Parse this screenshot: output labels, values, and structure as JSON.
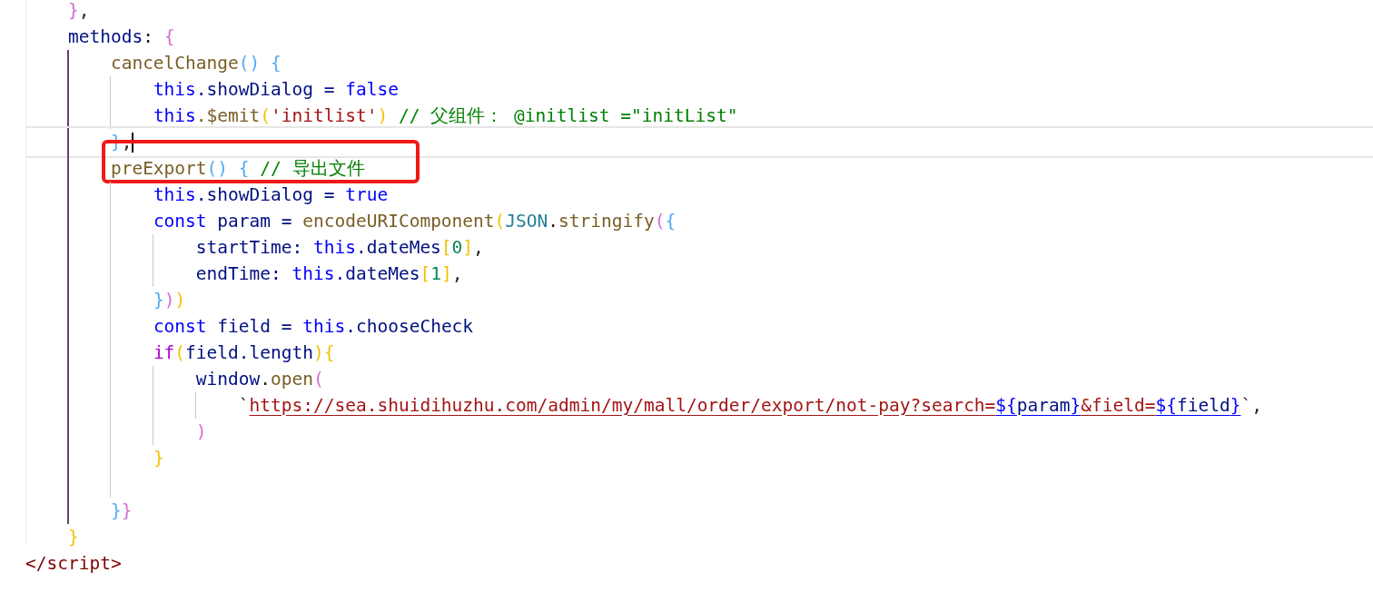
{
  "editor": {
    "lines": [
      {
        "kind": "code",
        "current": false,
        "annotated": false,
        "tokens": [
          {
            "text": "}",
            "kind": "b2"
          },
          {
            "text": ",",
            "kind": "p"
          }
        ]
      },
      {
        "kind": "code",
        "current": false,
        "annotated": false,
        "tokens": [
          {
            "text": "methods",
            "kind": "v"
          },
          {
            "text": ": ",
            "kind": "p"
          },
          {
            "text": "{",
            "kind": "b2"
          }
        ],
        "children": [
          {
            "kind": "code",
            "current": false,
            "annotated": false,
            "tokens": [
              {
                "text": "cancelChange",
                "kind": "f"
              },
              {
                "text": "() {",
                "kind": "b3"
              }
            ],
            "children": [
              {
                "kind": "code",
                "current": false,
                "annotated": false,
                "tokens": [
                  {
                    "text": "this",
                    "kind": "k"
                  },
                  {
                    "text": ".showDialog = ",
                    "kind": "v"
                  },
                  {
                    "text": "false",
                    "kind": "k"
                  }
                ]
              },
              {
                "kind": "code",
                "current": false,
                "annotated": false,
                "tokens": [
                  {
                    "text": "this",
                    "kind": "k"
                  },
                  {
                    "text": ".$emit",
                    "kind": "f"
                  },
                  {
                    "text": "(",
                    "kind": "b1"
                  },
                  {
                    "text": "'initlist'",
                    "kind": "s"
                  },
                  {
                    "text": ")",
                    "kind": "b1"
                  },
                  {
                    "text": " // 父组件： @initlist =\"initList\"",
                    "kind": "c"
                  }
                ]
              }
            ]
          },
          {
            "kind": "code",
            "current": true,
            "annotated": false,
            "tokens": [
              {
                "text": "}",
                "kind": "b3"
              },
              {
                "text": ",",
                "kind": "p"
              }
            ]
          },
          {
            "kind": "code",
            "current": false,
            "annotated": true,
            "tokens": [
              {
                "text": "preExport",
                "kind": "f"
              },
              {
                "text": "() {",
                "kind": "b3"
              },
              {
                "text": " // 导出文件",
                "kind": "c"
              }
            ],
            "children": [
              {
                "kind": "code",
                "current": false,
                "annotated": false,
                "tokens": [
                  {
                    "text": "this",
                    "kind": "k"
                  },
                  {
                    "text": ".showDialog = ",
                    "kind": "v"
                  },
                  {
                    "text": "true",
                    "kind": "k"
                  }
                ]
              },
              {
                "kind": "code",
                "current": false,
                "annotated": false,
                "tokens": [
                  {
                    "text": "const",
                    "kind": "k"
                  },
                  {
                    "text": " param = ",
                    "kind": "v"
                  },
                  {
                    "text": "encodeURIComponent",
                    "kind": "f"
                  },
                  {
                    "text": "(",
                    "kind": "b1"
                  },
                  {
                    "text": "JSON",
                    "kind": "t"
                  },
                  {
                    "text": ".",
                    "kind": "p"
                  },
                  {
                    "text": "stringify",
                    "kind": "f"
                  },
                  {
                    "text": "(",
                    "kind": "b2"
                  },
                  {
                    "text": "{",
                    "kind": "b3"
                  }
                ],
                "children": [
                  {
                    "kind": "code",
                    "current": false,
                    "annotated": false,
                    "tokens": [
                      {
                        "text": "startTime: ",
                        "kind": "v"
                      },
                      {
                        "text": "this",
                        "kind": "k"
                      },
                      {
                        "text": ".dateMes",
                        "kind": "v"
                      },
                      {
                        "text": "[",
                        "kind": "b1"
                      },
                      {
                        "text": "0",
                        "kind": "n"
                      },
                      {
                        "text": "]",
                        "kind": "b1"
                      },
                      {
                        "text": ",",
                        "kind": "p"
                      }
                    ]
                  },
                  {
                    "kind": "code",
                    "current": false,
                    "annotated": false,
                    "tokens": [
                      {
                        "text": "endTime: ",
                        "kind": "v"
                      },
                      {
                        "text": "this",
                        "kind": "k"
                      },
                      {
                        "text": ".dateMes",
                        "kind": "v"
                      },
                      {
                        "text": "[",
                        "kind": "b1"
                      },
                      {
                        "text": "1",
                        "kind": "n"
                      },
                      {
                        "text": "]",
                        "kind": "b1"
                      },
                      {
                        "text": ",",
                        "kind": "p"
                      }
                    ]
                  }
                ]
              },
              {
                "kind": "code",
                "current": false,
                "annotated": false,
                "tokens": [
                  {
                    "text": "}",
                    "kind": "b3"
                  },
                  {
                    "text": ")",
                    "kind": "b2"
                  },
                  {
                    "text": ")",
                    "kind": "b1"
                  }
                ]
              },
              {
                "kind": "code",
                "current": false,
                "annotated": false,
                "tokens": [
                  {
                    "text": "const",
                    "kind": "k"
                  },
                  {
                    "text": " field = ",
                    "kind": "v"
                  },
                  {
                    "text": "this",
                    "kind": "k"
                  },
                  {
                    "text": ".chooseCheck",
                    "kind": "v"
                  }
                ]
              },
              {
                "kind": "code",
                "current": false,
                "annotated": false,
                "tokens": [
                  {
                    "text": "if",
                    "kind": "x"
                  },
                  {
                    "text": "(",
                    "kind": "b1"
                  },
                  {
                    "text": "field.length",
                    "kind": "v"
                  },
                  {
                    "text": "){",
                    "kind": "b1"
                  }
                ],
                "children": [
                  {
                    "kind": "code",
                    "current": false,
                    "annotated": false,
                    "tokens": [
                      {
                        "text": "window",
                        "kind": "v"
                      },
                      {
                        "text": ".",
                        "kind": "p"
                      },
                      {
                        "text": "open",
                        "kind": "f"
                      },
                      {
                        "text": "(",
                        "kind": "b2"
                      }
                    ],
                    "children": [
                      {
                        "kind": "code",
                        "current": false,
                        "annotated": false,
                        "tokens": [
                          {
                            "text": "`",
                            "kind": "p"
                          },
                          {
                            "text": "https://sea.shuidihuzhu.com/admin/my/mall/order/export/not-pay?search=",
                            "kind": "u"
                          },
                          {
                            "text": "${",
                            "kind": "id"
                          },
                          {
                            "text": "param",
                            "kind": "iv"
                          },
                          {
                            "text": "}",
                            "kind": "id"
                          },
                          {
                            "text": "&field=",
                            "kind": "u"
                          },
                          {
                            "text": "${",
                            "kind": "id"
                          },
                          {
                            "text": "field",
                            "kind": "iv"
                          },
                          {
                            "text": "}",
                            "kind": "id"
                          },
                          {
                            "text": "`,",
                            "kind": "p"
                          }
                        ]
                      }
                    ]
                  },
                  {
                    "kind": "code",
                    "current": false,
                    "annotated": false,
                    "tokens": [
                      {
                        "text": ")",
                        "kind": "b2"
                      }
                    ]
                  }
                ]
              },
              {
                "kind": "code",
                "current": false,
                "annotated": false,
                "tokens": [
                  {
                    "text": "}",
                    "kind": "b1"
                  }
                ]
              },
              {
                "kind": "blank"
              }
            ]
          },
          {
            "kind": "code",
            "current": false,
            "annotated": false,
            "tokens": [
              {
                "text": "}",
                "kind": "b3"
              },
              {
                "text": "}",
                "kind": "b2"
              }
            ]
          }
        ]
      },
      {
        "kind": "code",
        "current": false,
        "annotated": false,
        "tokens": [
          {
            "text": "}",
            "kind": "b1"
          }
        ]
      }
    ],
    "closing_tag": {
      "text": "</script>"
    }
  }
}
